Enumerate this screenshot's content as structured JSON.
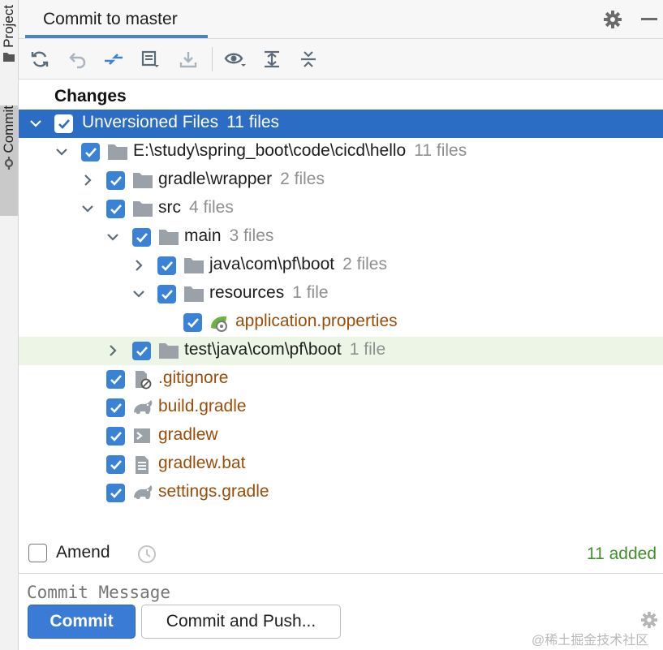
{
  "sidebar": {
    "tabs": [
      {
        "label": "Project",
        "icon": "folder-icon"
      },
      {
        "label": "Commit",
        "icon": "commit-icon"
      }
    ]
  },
  "header": {
    "tab_label": "Commit to master",
    "icons": [
      "gear-icon",
      "minimize-icon"
    ]
  },
  "toolbar": {
    "buttons": [
      "refresh-icon",
      "rollback-icon",
      "show-diff-icon",
      "shelve-icon",
      "download-icon",
      "eye-icon",
      "expand-all-icon",
      "collapse-all-icon"
    ]
  },
  "tree": {
    "title": "Changes",
    "rows": [
      {
        "label": "Unversioned Files",
        "count": "11 files"
      },
      {
        "label": "E:\\study\\spring_boot\\code\\cicd\\hello",
        "count": "11 files"
      },
      {
        "label": "gradle\\wrapper",
        "count": "2 files"
      },
      {
        "label": "src",
        "count": "4 files"
      },
      {
        "label": "main",
        "count": "3 files"
      },
      {
        "label": "java\\com\\pf\\boot",
        "count": "2 files"
      },
      {
        "label": "resources",
        "count": "1 file"
      },
      {
        "label": "application.properties"
      },
      {
        "label": "test\\java\\com\\pf\\boot",
        "count": "1 file"
      },
      {
        "label": ".gitignore"
      },
      {
        "label": "build.gradle"
      },
      {
        "label": "gradlew"
      },
      {
        "label": "gradlew.bat"
      },
      {
        "label": "settings.gradle"
      }
    ]
  },
  "amend": {
    "label": "Amend",
    "added": "11 added"
  },
  "message": {
    "placeholder": "Commit Message"
  },
  "buttons": {
    "commit": "Commit",
    "commit_and_push": "Commit and Push..."
  },
  "watermark": "@稀土掘金技术社区",
  "colors": {
    "selection": "#2b6cc4",
    "checkbox": "#3a82d6",
    "unversioned_text": "#9a4d08",
    "added_text": "#3f8e2b",
    "primary_button": "#3a7bd5"
  }
}
